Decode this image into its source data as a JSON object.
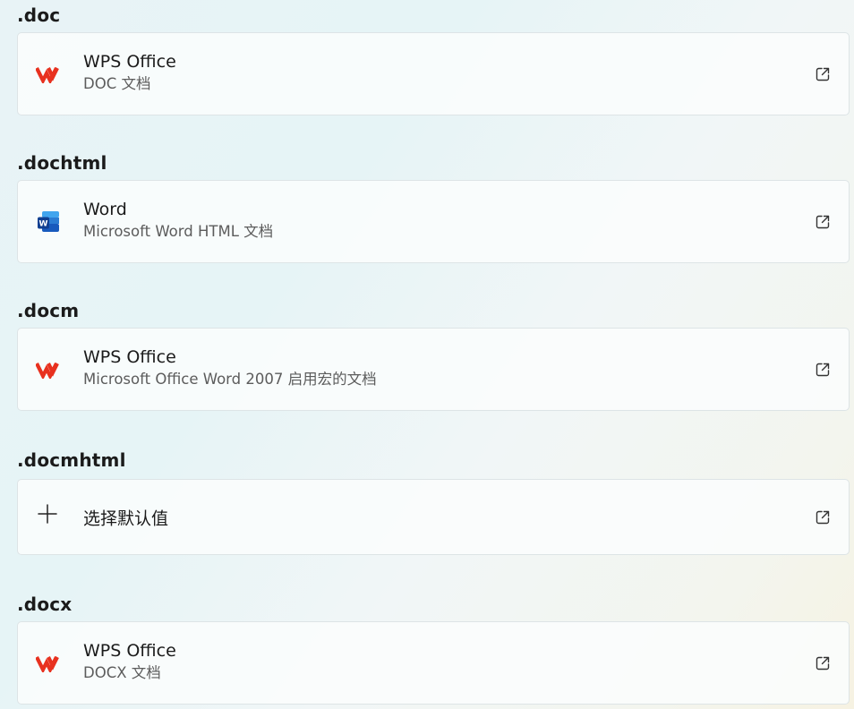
{
  "sections": [
    {
      "extension": ".doc",
      "app_icon": "wps-office-icon",
      "app_name": "WPS Office",
      "description": "DOC 文档"
    },
    {
      "extension": ".dochtml",
      "app_icon": "microsoft-word-icon",
      "app_name": "Word",
      "description": "Microsoft Word HTML 文档"
    },
    {
      "extension": ".docm",
      "app_icon": "wps-office-icon",
      "app_name": "WPS Office",
      "description": "Microsoft Office Word 2007 启用宏的文档"
    },
    {
      "extension": ".docmhtml",
      "app_icon": "plus-icon",
      "label": "选择默认值"
    },
    {
      "extension": ".docx",
      "app_icon": "wps-office-icon",
      "app_name": "WPS Office",
      "description": "DOCX 文档"
    }
  ],
  "colors": {
    "wps_red": "#e8311f",
    "word_blue": "#185abd",
    "text_primary": "#1b1b1b",
    "text_secondary": "#5c5c5c"
  },
  "card_action_icon": "open-external-icon"
}
